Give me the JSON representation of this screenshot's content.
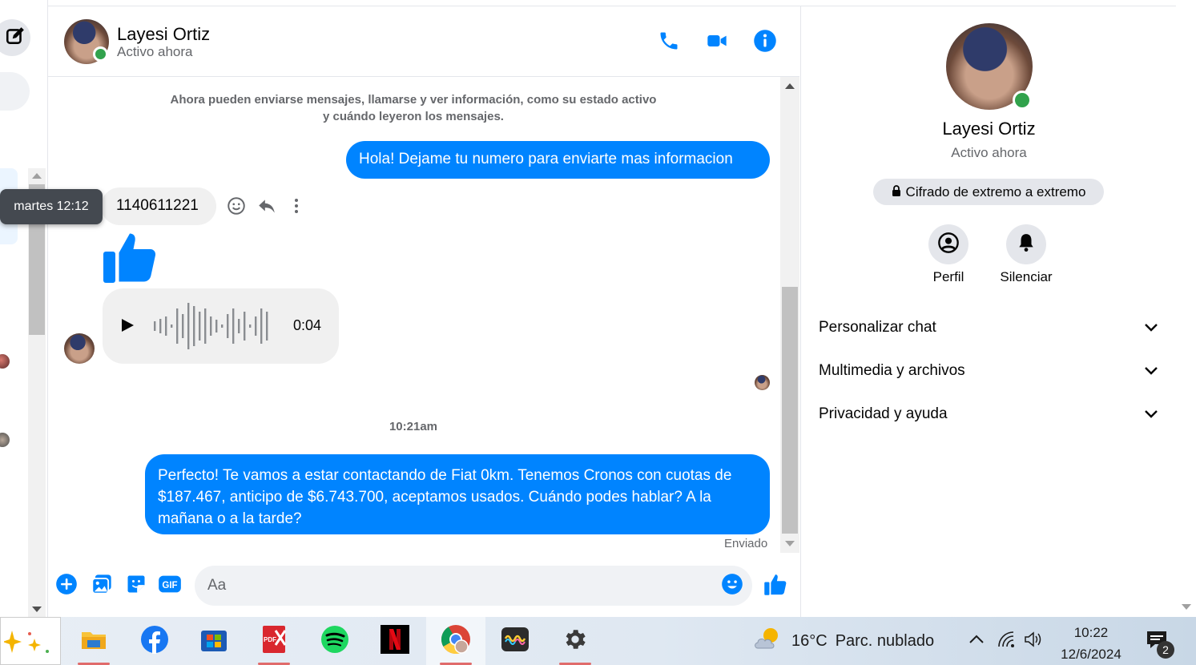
{
  "header": {
    "name": "Layesi Ortiz",
    "status": "Activo ahora"
  },
  "conversation": {
    "system_note_line1": "Ahora pueden enviarse mensajes, llamarse y ver información, como su estado activo",
    "system_note_line2": "y cuándo leyeron los mensajes.",
    "outgoing_1": "Hola! Dejame tu numero para enviarte mas informacion",
    "incoming_1": "1140611221",
    "tooltip": "martes 12:12",
    "audio_duration": "0:04",
    "timestamp": "10:21am",
    "outgoing_2_line1": "Perfecto! Te vamos a estar contactando de Fiat 0km. Tenemos Cronos con cuotas de",
    "outgoing_2_line2": "$187.467, anticipo de $6.743.700, aceptamos usados. Cuándo podes hablar? A la",
    "outgoing_2_line3": "mañana o a la tarde?",
    "sent_label": "Enviado"
  },
  "composer": {
    "placeholder": "Aa"
  },
  "right_panel": {
    "name": "Layesi Ortiz",
    "status": "Activo ahora",
    "encryption": "Cifrado de extremo a extremo",
    "profile_label": "Perfil",
    "mute_label": "Silenciar",
    "sections": [
      "Personalizar chat",
      "Multimedia y archivos",
      "Privacidad y ayuda"
    ]
  },
  "taskbar": {
    "weather_temp": "16°C",
    "weather_desc": "Parc. nublado",
    "time": "10:22",
    "date": "12/6/2024",
    "notifications": "2",
    "apps": [
      "copilot-icon",
      "file-explorer-icon",
      "facebook-icon",
      "microsoft-store-icon",
      "pdf-icon",
      "spotify-icon",
      "netflix-icon",
      "chrome-icon",
      "app-icon",
      "settings-icon"
    ]
  },
  "colors": {
    "accent": "#0084ff",
    "online": "#31a24c",
    "bubble_in": "#f0f0f0"
  }
}
